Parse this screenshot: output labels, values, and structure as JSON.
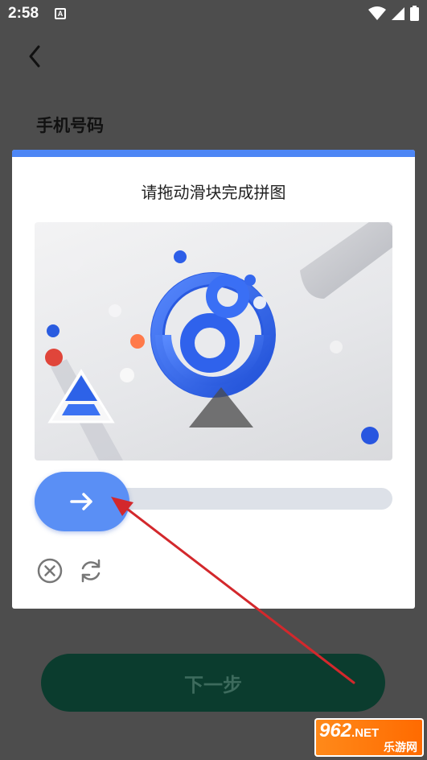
{
  "status_bar": {
    "time": "2:58",
    "notification_icon": "A",
    "icons": [
      "wifi-icon",
      "signal-icon",
      "battery-icon"
    ]
  },
  "page": {
    "title": "手机号码",
    "back_icon": "chevron-left-icon"
  },
  "captcha": {
    "title": "请拖动滑块完成拼图",
    "accent_color": "#4d86f5",
    "slider_position": 0,
    "knob_icon": "arrow-right-icon",
    "close_icon": "close-circle-icon",
    "refresh_icon": "refresh-icon"
  },
  "next_button": {
    "label": "下一步",
    "color": "#0b3c2e"
  },
  "watermark": {
    "brand": "962",
    "suffix": ".NET",
    "sub": "乐游网"
  }
}
